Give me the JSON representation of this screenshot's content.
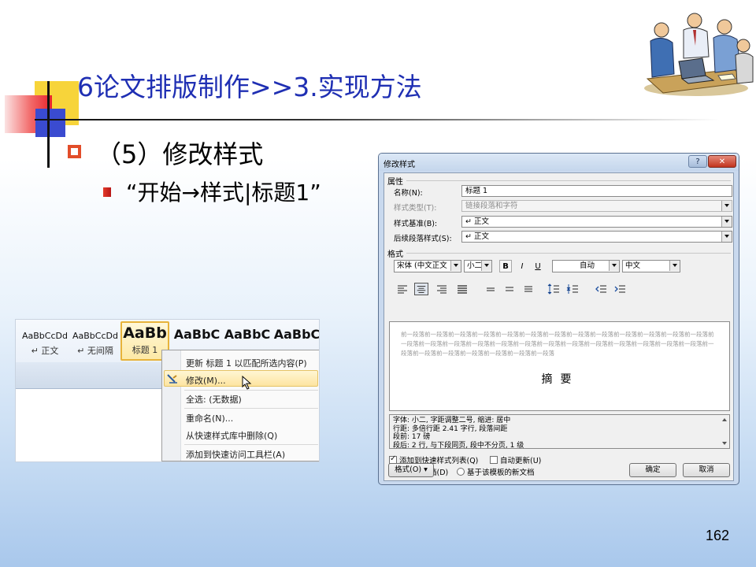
{
  "slide": {
    "title": "6论文排版制作>>3.实现方法",
    "bullet1": "（5）修改样式",
    "bullet2": "“开始→样式|标题1”",
    "page_number": "162"
  },
  "ribbon": {
    "styles": [
      {
        "sample": "AaBbCcDd",
        "name": "↵ 正文"
      },
      {
        "sample": "AaBbCcDd",
        "name": "↵ 无间隔"
      },
      {
        "sample": "AaBb",
        "name": "标题 1"
      },
      {
        "sample": "AaBbC",
        "name": ""
      },
      {
        "sample": "AaBbC",
        "name": ""
      },
      {
        "sample": "AaBbC",
        "name": ""
      }
    ],
    "context_menu": {
      "items": [
        "更新 标题 1 以匹配所选内容(P)",
        "修改(M)...",
        "全选: (无数据)",
        "重命名(N)...",
        "从快速样式库中删除(Q)",
        "添加到快速访问工具栏(A)"
      ]
    }
  },
  "dialog": {
    "title": "修改样式",
    "help_label": "?",
    "close_label": "✕",
    "section_properties": "属性",
    "properties": [
      {
        "label": "名称(N):",
        "value": "标题 1"
      },
      {
        "label": "样式类型(T):",
        "value": "链接段落和字符"
      },
      {
        "label": "样式基准(B):",
        "value": "↵ 正文"
      },
      {
        "label": "后续段落样式(S):",
        "value": "↵ 正文"
      }
    ],
    "section_format": "格式",
    "font_name": "宋体 (中文正文",
    "font_size": "小二",
    "bold_label": "B",
    "italic_label": "I",
    "underline_label": "U",
    "color_value": "自动",
    "language_value": "中文",
    "preview_sample": "前一段落前一段落前一段落前一段落前一段落前一段落前一段落前一段落前一段落前一段落前一段落前一段落前一段落前一段落前一段落前一段落前一段落前一段落前一段落前一段落前一段落前一段落前一段落前一段落前一段落前一段落前一段落前一段落前一段落前一段落前一段落前一段落前一段落",
    "preview_heading": "摘要",
    "description_lines": [
      "字体: 小二, 字距调整二号, 缩进: 居中",
      "    行距: 多倍行距 2.41 字行, 段落间距",
      "    段前: 17 磅",
      "    段后: 2 行, 与下段同页, 段中不分页, 1 级"
    ],
    "add_to_quick_style": "添加到快速样式列表(Q)",
    "auto_update": "自动更新(U)",
    "only_this_doc": "仅限此文档(D)",
    "new_docs_template": "基于该模板的新文档",
    "format_button": "格式(O) ▾",
    "ok_button": "确定",
    "cancel_button": "取消"
  }
}
